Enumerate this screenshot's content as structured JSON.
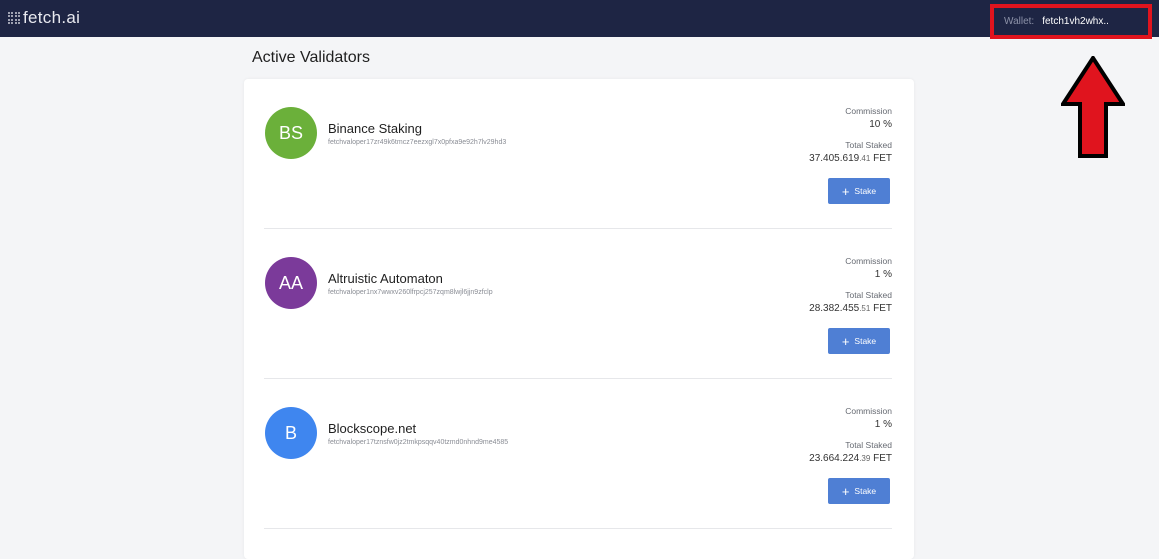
{
  "header": {
    "logo_text": "fetch.ai",
    "wallet_label": "Wallet:",
    "wallet_address": "fetch1vh2whx.."
  },
  "page_title": "Active Validators",
  "labels": {
    "commission": "Commission",
    "total_staked": "Total Staked",
    "stake_button": "Stake"
  },
  "validators": [
    {
      "initials": "BS",
      "name": "Binance Staking",
      "address": "fetchvaloper17zr49k6tmcz7eezxgl7x0pfxa9e92h7lv29hd3",
      "commission": "10 %",
      "total_staked_main": "37.405.619",
      "total_staked_dec": ".41",
      "unit": "FET",
      "avatar_color": "#6bb03a"
    },
    {
      "initials": "AA",
      "name": "Altruistic Automaton",
      "address": "fetchvaloper1nx7wwxv260lfrpcj257zqm8lwjl6jjn9zfclp",
      "commission": "1 %",
      "total_staked_main": "28.382.455",
      "total_staked_dec": ".51",
      "unit": "FET",
      "avatar_color": "#7b3a9a"
    },
    {
      "initials": "B",
      "name": "Blockscope.net",
      "address": "fetchvaloper17tznsfw0jz2tmkpsqqv40tzmd0nhnd9me4585",
      "commission": "1 %",
      "total_staked_main": "23.664.224",
      "total_staked_dec": ".39",
      "unit": "FET",
      "avatar_color": "#3f86ef"
    }
  ]
}
